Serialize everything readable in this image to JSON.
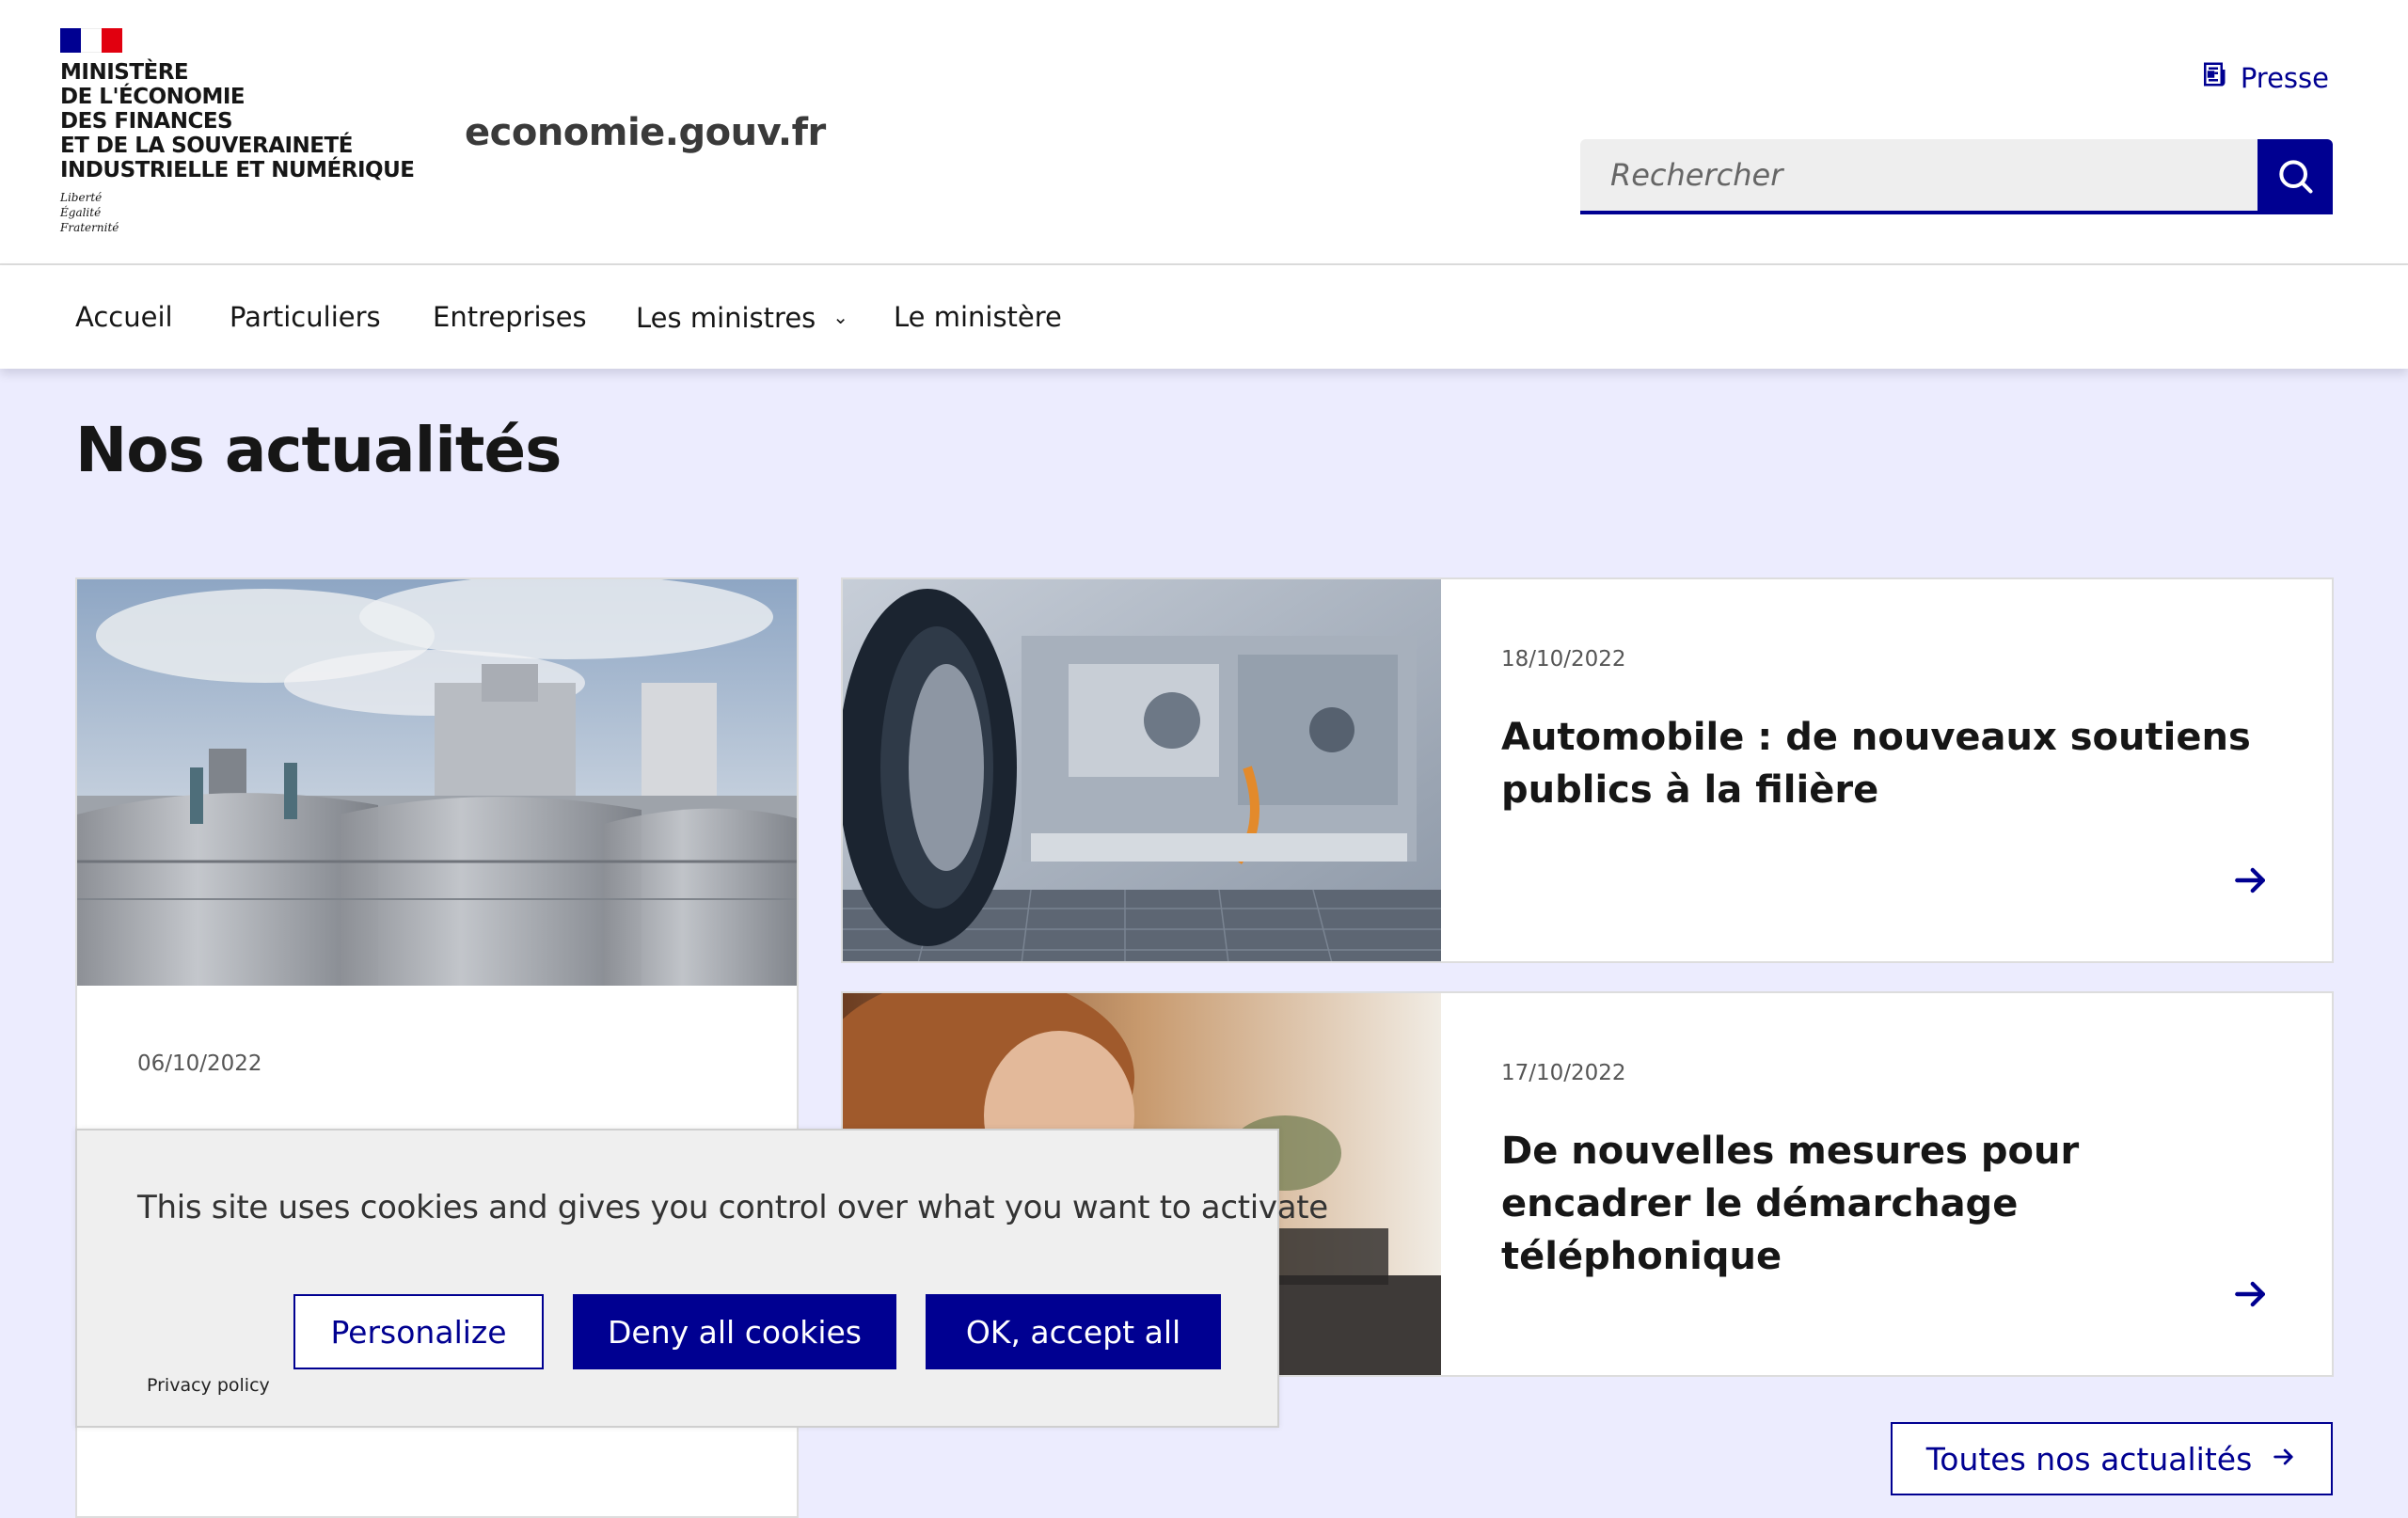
{
  "header": {
    "ministry_lines": [
      "Ministère",
      "de l'Économie",
      "des Finances",
      "et de la Souveraineté",
      "industrielle et numérique"
    ],
    "motto": [
      "Liberté",
      "Égalité",
      "Fraternité"
    ],
    "site_title": "economie.gouv.fr",
    "presse_label": "Presse",
    "search_placeholder": "Rechercher",
    "flag_colors": {
      "blue": "#000091",
      "white": "#ffffff",
      "red": "#e1000f"
    },
    "icons": {
      "presse": "newspaper-icon",
      "search": "search-icon"
    }
  },
  "nav": {
    "items": [
      {
        "label": "Accueil"
      },
      {
        "label": "Particuliers"
      },
      {
        "label": "Entreprises"
      },
      {
        "label": "Les ministres",
        "dropdown": true
      },
      {
        "label": "Le ministère"
      }
    ]
  },
  "main": {
    "section_title": "Nos actualités",
    "featured": {
      "date": "06/10/2022"
    },
    "news": [
      {
        "date": "18/10/2022",
        "title": "Automobile : de nouveaux soutiens publics à la filière"
      },
      {
        "date": "17/10/2022",
        "title": "De nouvelles mesures pour encadrer le démarchage téléphonique"
      }
    ],
    "all_news_label": "Toutes nos actualités",
    "accent_color": "#000091",
    "background_color": "#ececfe"
  },
  "cookie_banner": {
    "text": "This site uses cookies and gives you control over what you want to activate",
    "personalize_label": "Personalize",
    "deny_label": "Deny all cookies",
    "accept_label": "OK, accept all",
    "privacy_label": "Privacy policy"
  }
}
